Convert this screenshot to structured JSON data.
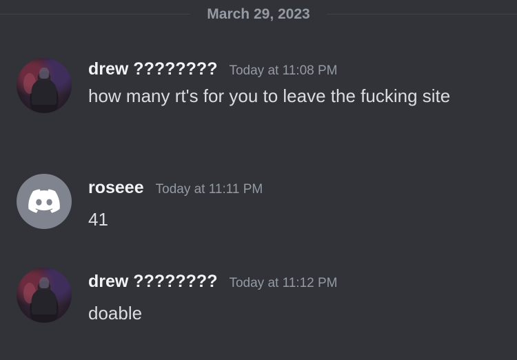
{
  "divider": {
    "date": "March 29, 2023"
  },
  "messages": [
    {
      "username": "drew ????????",
      "timestamp": "Today at 11:08 PM",
      "text": "how many rt's for you to leave the fucking site",
      "avatar_icon": "profile-photo"
    },
    {
      "username": "roseee",
      "timestamp": "Today at 11:11 PM",
      "text": "41",
      "avatar_icon": "discord-logo-icon"
    },
    {
      "username": "drew ????????",
      "timestamp": "Today at 11:12 PM",
      "text": "doable",
      "avatar_icon": "profile-photo"
    }
  ],
  "colors": {
    "background": "#313338",
    "username": "#f2f3f5",
    "timestamp": "#949ba4",
    "text": "#dbdee1",
    "default_avatar": "#80848e"
  }
}
